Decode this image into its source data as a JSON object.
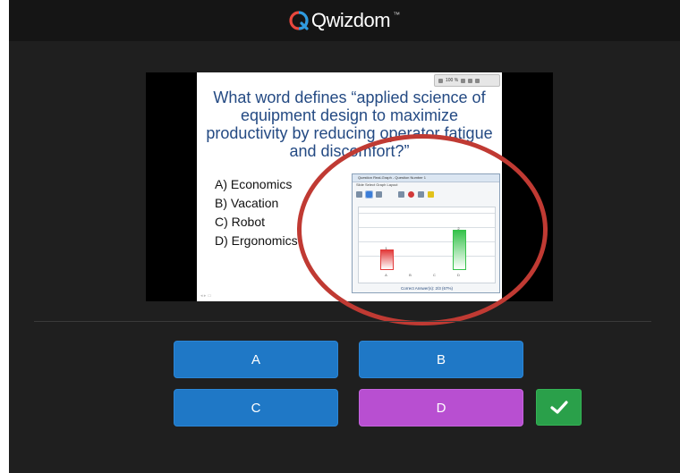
{
  "header": {
    "brand": "Qwizdom",
    "trademark": "™",
    "brand_colors": [
      "#e8473d",
      "#2f9be0",
      "#ffffff"
    ]
  },
  "slide": {
    "question": "What word defines “applied science of equipment design to maximize productivity by reducing operator fatigue and discomfort?”",
    "answers": [
      "A) Economics",
      "B) Vacation",
      "C) Robot",
      "D) Ergonomics"
    ],
    "toolbar_zoom": "100 %",
    "results_window": {
      "title": "Question Real-Graph - Question Number 1",
      "menu": "Slide   Select Graph Layout",
      "caption": "Correct Answer(s): 2/3 (67%)"
    }
  },
  "chart_data": {
    "type": "bar",
    "categories": [
      "A",
      "B",
      "C",
      "D"
    ],
    "values": [
      1,
      0,
      0,
      2
    ],
    "bar_colors": [
      "#e23b3b",
      "#e23b3b",
      "#e23b3b",
      "#36c24b"
    ],
    "ylim": [
      0,
      3
    ],
    "grid": true
  },
  "answer_buttons": [
    {
      "label": "A",
      "color": "#1f78c6"
    },
    {
      "label": "B",
      "color": "#1f78c6"
    },
    {
      "label": "C",
      "color": "#1f78c6"
    },
    {
      "label": "D",
      "color": "#b84fd1"
    }
  ],
  "submit": {
    "icon": "checkmark-icon",
    "color": "#2aa04a"
  },
  "annotation_color": "#c03a33"
}
